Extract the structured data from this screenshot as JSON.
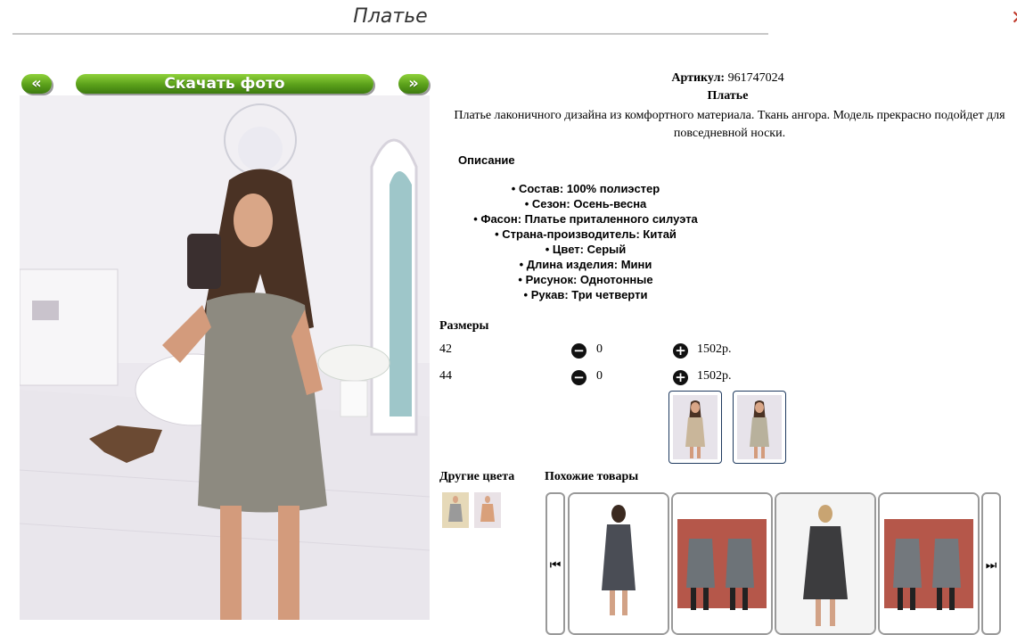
{
  "page": {
    "title": "Платье"
  },
  "nav": {
    "prev": "«",
    "download": "Скачать фото",
    "next": "»"
  },
  "product": {
    "article_label": "Артикул:",
    "article_value": "961747024",
    "name": "Платье",
    "description": "Платье лаконичного дизайна из комфортного материала. Ткань ангора. Модель прекрасно подойдет для повседневной носки.",
    "description_heading": "Описание",
    "specs": [
      "Состав: 100% полиэстер",
      "Сезон: Осень-весна",
      "Фасон: Платье приталенного силуэта",
      "Страна-производитель: Китай",
      "Цвет: Серый",
      "Длина изделия: Мини",
      "Рисунок: Однотонные",
      "Рукав: Три четверти"
    ]
  },
  "sizes": {
    "heading": "Размеры",
    "rows": [
      {
        "size": "42",
        "qty": "0",
        "price": "1502р."
      },
      {
        "size": "44",
        "qty": "0",
        "price": "1502р."
      }
    ],
    "minus_glyph": "−",
    "plus_glyph": "+"
  },
  "other_colors": {
    "heading": "Другие цвета"
  },
  "similar": {
    "heading": "Похожие товары",
    "prev_glyph": "⏮",
    "next_glyph": "⏭"
  },
  "icons": [
    "close-icon",
    "minus-icon",
    "plus-icon",
    "carousel-prev-icon",
    "carousel-next-icon"
  ],
  "colors": {
    "button_green": "#5aa01a",
    "thumb_border": "#1f3a5f",
    "close_red": "#c0392b"
  }
}
